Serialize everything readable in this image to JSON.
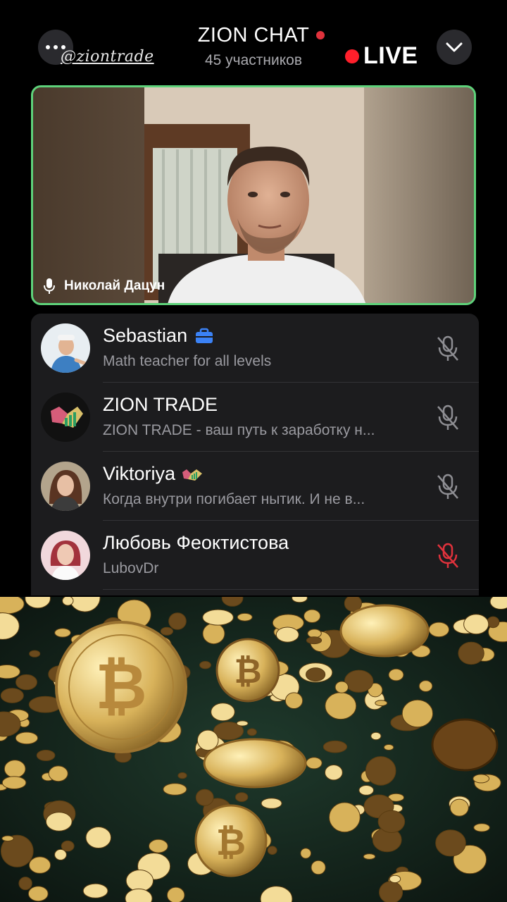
{
  "header": {
    "title": "ZION CHAT",
    "participants": "45 участников",
    "watermark": "@ziontrade",
    "live_label": "LIVE",
    "more_icon": "more-dots-icon",
    "collapse_icon": "chevron-down-icon"
  },
  "video": {
    "speaker_name": "Николай Дацун",
    "speaking": true,
    "border_color": "#5ed27a"
  },
  "participants": [
    {
      "name": "Sebastian",
      "status": "Math teacher for all levels",
      "badge_icon": "briefcase-icon",
      "muted": false
    },
    {
      "name": "ZION TRADE",
      "status": "ZION TRADE - ваш путь к заработку н...",
      "muted": false
    },
    {
      "name": "Viktoriya",
      "status": "Когда внутри погибает нытик. И не в...",
      "badge_icon": "zion-logo-icon",
      "muted": false
    },
    {
      "name": "Любовь Феоктистова",
      "status": "LubovDr",
      "muted": true
    }
  ],
  "colors": {
    "live_dot": "#ff1f2b",
    "mic_muted_red": "#e0323c",
    "mic_gray": "#8e8e93",
    "panel_bg": "#1c1c1e"
  }
}
